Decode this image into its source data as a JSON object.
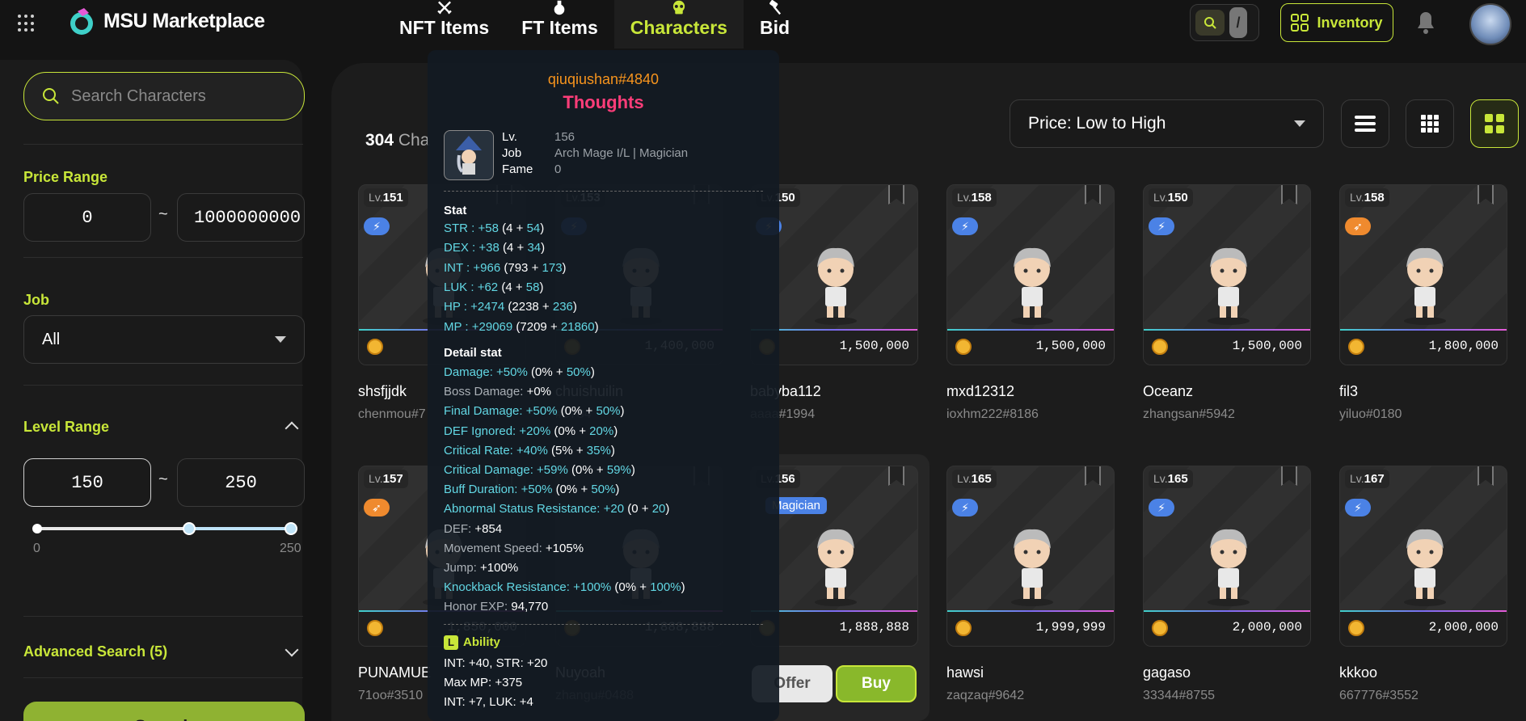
{
  "header": {
    "logo_text": "MSU Marketplace",
    "nav": [
      {
        "label": "NFT Items",
        "icon": "crossed-swords-icon"
      },
      {
        "label": "FT Items",
        "icon": "potion-icon"
      },
      {
        "label": "Characters",
        "icon": "skull-icon",
        "active": true
      },
      {
        "label": "Bid",
        "icon": "gavel-icon"
      }
    ],
    "search_toggle_slash": "/",
    "inventory_label": "Inventory"
  },
  "sidebar": {
    "search_placeholder": "Search Characters",
    "price_range_label": "Price Range",
    "price_min": "0",
    "price_max": "1000000000",
    "tilde": "~",
    "job_label": "Job",
    "job_value": "All",
    "level_range_label": "Level Range",
    "level_min": "150",
    "level_max": "250",
    "slider_min_label": "0",
    "slider_max_label": "250",
    "slider_low": 150,
    "slider_high": 250,
    "advanced_label": "Advanced Search (5)",
    "search_button": "Search"
  },
  "main": {
    "count_number": "304",
    "count_suffix": "Cha",
    "sort_value": "Price: Low to High"
  },
  "cards": [
    {
      "level": "151",
      "job": "magician",
      "price": "",
      "name": "shsfjjdk",
      "owner": "chenmou#7"
    },
    {
      "level": "153",
      "job": "magician",
      "price": "1,400,000",
      "name": "chuishuilin",
      "owner": "#5784"
    },
    {
      "level": "150",
      "job": "magician",
      "price": "1,500,000",
      "name": "babyba112",
      "owner": "aaaa#1994"
    },
    {
      "level": "158",
      "job": "magician",
      "price": "1,500,000",
      "name": "mxd12312",
      "owner": "ioxhm222#8186"
    },
    {
      "level": "150",
      "job": "magician",
      "price": "1,500,000",
      "name": "Oceanz",
      "owner": "zhangsan#5942"
    },
    {
      "level": "158",
      "job": "bowman",
      "price": "1,800,000",
      "name": "fil3",
      "owner": "yiluo#0180"
    },
    {
      "level": "157",
      "job": "bowman",
      "price": "1,850,000",
      "name": "PUNAMUE",
      "owner": "71oo#3510"
    },
    {
      "level": "",
      "job": "",
      "price": "1,888,888",
      "name": "Nuyoah",
      "owner": "zhangu#0488"
    },
    {
      "level": "156",
      "job": "magician",
      "price": "1,888,888",
      "name": "",
      "owner": "",
      "tag": "Magician"
    },
    {
      "level": "165",
      "job": "magician",
      "price": "1,999,999",
      "name": "hawsi",
      "owner": "zaqzaq#9642"
    },
    {
      "level": "165",
      "job": "magician",
      "price": "2,000,000",
      "name": "gagaso",
      "owner": "33344#8755"
    },
    {
      "level": "167",
      "job": "magician",
      "price": "2,000,000",
      "name": "kkkoo",
      "owner": "667776#3552"
    }
  ],
  "card_lv_prefix": "Lv.",
  "actions": {
    "offer": "Offer",
    "buy": "Buy"
  },
  "tooltip": {
    "owner": "qiuqiushan#4840",
    "name": "Thoughts",
    "lv_label": "Lv.",
    "lv_value": "156",
    "job_label": "Job",
    "job_value": "Arch Mage I/L | Magician",
    "fame_label": "Fame",
    "fame_value": "0",
    "stat_heading": "Stat",
    "stats": [
      {
        "k": "STR :",
        "total": "+58",
        "base": "4",
        "bonus": "54"
      },
      {
        "k": "DEX :",
        "total": "+38",
        "base": "4",
        "bonus": "34"
      },
      {
        "k": "INT :",
        "total": "+966",
        "base": "793",
        "bonus": "173"
      },
      {
        "k": "LUK :",
        "total": "+62",
        "base": "4",
        "bonus": "58"
      },
      {
        "k": "HP :",
        "total": "+2474",
        "base": "2238",
        "bonus": "236"
      },
      {
        "k": "MP :",
        "total": "+29069",
        "base": "7209",
        "bonus": "21860"
      }
    ],
    "detail_heading": "Detail stat",
    "details": [
      {
        "k": "Damage:",
        "total": "+50%",
        "base": "0%",
        "bonus": "50%",
        "hl": true
      },
      {
        "k": "Boss Damage:",
        "total": "+0%",
        "hl": false
      },
      {
        "k": "Final Damage:",
        "total": "+50%",
        "base": "0%",
        "bonus": "50%",
        "hl": true
      },
      {
        "k": "DEF Ignored:",
        "total": "+20%",
        "base": "0%",
        "bonus": "20%",
        "hl": true
      },
      {
        "k": "Critical Rate:",
        "total": "+40%",
        "base": "5%",
        "bonus": "35%",
        "hl": true
      },
      {
        "k": "Critical Damage:",
        "total": "+59%",
        "base": "0%",
        "bonus": "59%",
        "hl": true
      },
      {
        "k": "Buff Duration:",
        "total": "+50%",
        "base": "0%",
        "bonus": "50%",
        "hl": true
      },
      {
        "k": "Abnormal Status Resistance:",
        "total": "+20",
        "base": "0",
        "bonus": "20",
        "hl": true
      },
      {
        "k": "DEF:",
        "total": "+854",
        "hl": false
      },
      {
        "k": "Movement Speed:",
        "total": "+105%",
        "hl": false
      },
      {
        "k": "Jump:",
        "total": "+100%",
        "hl": false
      },
      {
        "k": "Knockback Resistance:",
        "total": "+100%",
        "base": "0%",
        "bonus": "100%",
        "hl": true
      },
      {
        "k": "Honor EXP:",
        "total": "94,770",
        "hl": false
      }
    ],
    "ability_badge": "L",
    "ability_heading": "Ability",
    "abilities": [
      "INT: +40, STR: +20",
      "Max MP: +375",
      "INT: +7, LUK: +4"
    ]
  },
  "colors": {
    "accent": "#c8e639",
    "magician": "#4b82e6",
    "bowman": "#ef8a2e",
    "tooltip_cyan": "#62d7e4",
    "owner_orange": "#f7941d",
    "name_pink": "#ff3d79"
  }
}
